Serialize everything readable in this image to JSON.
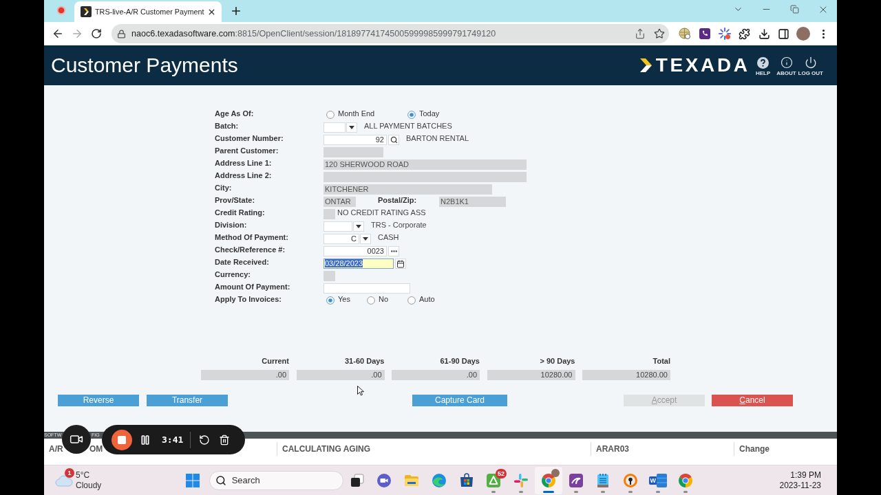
{
  "browser": {
    "tab": {
      "title": "TRS-live-A/R Customer Payment",
      "selected": true
    },
    "url": {
      "host": "naoc6.texadasoftware.com",
      "path": ":8815/OpenClient/session/181897741745005999985999791749120"
    }
  },
  "app_header": {
    "title": "Customer Payments",
    "logo": "TEXADA",
    "actions": [
      {
        "kind": "help",
        "label": "HELP"
      },
      {
        "kind": "about",
        "label": "ABOUT"
      },
      {
        "kind": "logout",
        "label": "LOG OUT"
      }
    ]
  },
  "form": {
    "rows": [
      {
        "kind": "radio",
        "label": "Age As Of:",
        "options": [
          {
            "label": "Month End",
            "selected": false
          },
          {
            "label": "Today",
            "selected": true
          }
        ]
      },
      {
        "kind": "dropdown",
        "label": "Batch:",
        "description": "ALL PAYMENT BATCHES"
      },
      {
        "kind": "lookup",
        "label": "Customer Number:",
        "value": "92",
        "description": "BARTON RENTAL"
      },
      {
        "kind": "readonly",
        "label": "Parent Customer:"
      },
      {
        "kind": "readonly",
        "label": "Address Line 1:",
        "value": "120 SHERWOOD ROAD"
      },
      {
        "kind": "readonly",
        "label": "Address Line 2:"
      },
      {
        "kind": "readonly",
        "label": "City:",
        "value": "KITCHENER"
      },
      {
        "kind": "pair",
        "label": "Prov/State:",
        "value": "ONTAR",
        "second_label": "Postal/Zip:",
        "second_value": "N2B1K1"
      },
      {
        "kind": "flag",
        "label": "Credit Rating:",
        "description": "NO CREDIT RATING ASS"
      },
      {
        "kind": "dropdown",
        "label": "Division:",
        "description": "TRS - Corporate"
      },
      {
        "kind": "dropdown",
        "label": "Method Of Payment:",
        "value": "C",
        "description": "CASH"
      },
      {
        "kind": "reference",
        "label": "Check/Reference #:",
        "value": "0023"
      },
      {
        "kind": "date",
        "label": "Date Received:",
        "value": "03/28/2023",
        "focused": true
      },
      {
        "kind": "readonly",
        "label": "Currency:"
      },
      {
        "kind": "text",
        "label": "Amount Of Payment:"
      },
      {
        "kind": "radio",
        "label": "Apply To Invoices:",
        "options": [
          {
            "label": "Yes",
            "selected": true
          },
          {
            "label": "No",
            "selected": false
          },
          {
            "label": "Auto",
            "selected": false
          }
        ]
      }
    ]
  },
  "aging": [
    {
      "header": "Current",
      "value": ".00"
    },
    {
      "header": "31-60 Days",
      "value": ".00"
    },
    {
      "header": "61-90 Days",
      "value": ".00"
    },
    {
      "header": "> 90 Days",
      "value": "10280.00"
    },
    {
      "header": "Total",
      "value": "10280.00"
    }
  ],
  "buttons": [
    {
      "label": "Reverse",
      "kind": "action",
      "disabled": false
    },
    {
      "label": "Transfer",
      "kind": "action",
      "disabled": false
    },
    {
      "label": "Capture Card",
      "kind": "action",
      "disabled": false
    },
    {
      "label": "Accept",
      "kind": "confirm",
      "disabled": true
    },
    {
      "label": "Cancel",
      "kind": "cancel",
      "disabled": false
    }
  ],
  "status_bar": {
    "strip_fragments": [
      "SOFTW",
      "FIG"
    ],
    "cells": [
      {
        "fragments": [
          "A/R",
          "OM"
        ]
      },
      {
        "fragments": [
          "CALCULATING AGING"
        ]
      },
      {
        "fragments": [
          "ARAR03"
        ]
      },
      {
        "fragments": [
          "Change"
        ]
      }
    ]
  },
  "recorder": {
    "timer": "3:41"
  },
  "taskbar": {
    "weather": {
      "badge": "1",
      "temperature": "5°C",
      "condition": "Cloudy"
    },
    "search": {
      "placeholder": "Search"
    },
    "apps": [
      {
        "kind": "taskview",
        "running": false,
        "selected": false
      },
      {
        "kind": "meet",
        "running": false,
        "selected": false
      },
      {
        "kind": "folder",
        "running": false,
        "selected": false
      },
      {
        "kind": "swirl",
        "running": false,
        "selected": false
      },
      {
        "kind": "store",
        "running": false,
        "selected": false
      },
      {
        "kind": "triangle",
        "badge": "52",
        "running": true,
        "selected": false
      },
      {
        "kind": "pinwheel",
        "running": true,
        "selected": false
      },
      {
        "kind": "browser_profile",
        "running": true,
        "selected": true
      },
      {
        "kind": "swoosh",
        "running": true,
        "selected": false
      },
      {
        "kind": "notepad",
        "running": true,
        "selected": false
      },
      {
        "kind": "keyhole",
        "running": true,
        "selected": false
      },
      {
        "kind": "document",
        "letter": "W",
        "running": true,
        "selected": false
      },
      {
        "kind": "browser",
        "running": true,
        "selected": false
      }
    ],
    "clock": {
      "time": "1:39 PM",
      "date": "2023-11-23"
    }
  }
}
